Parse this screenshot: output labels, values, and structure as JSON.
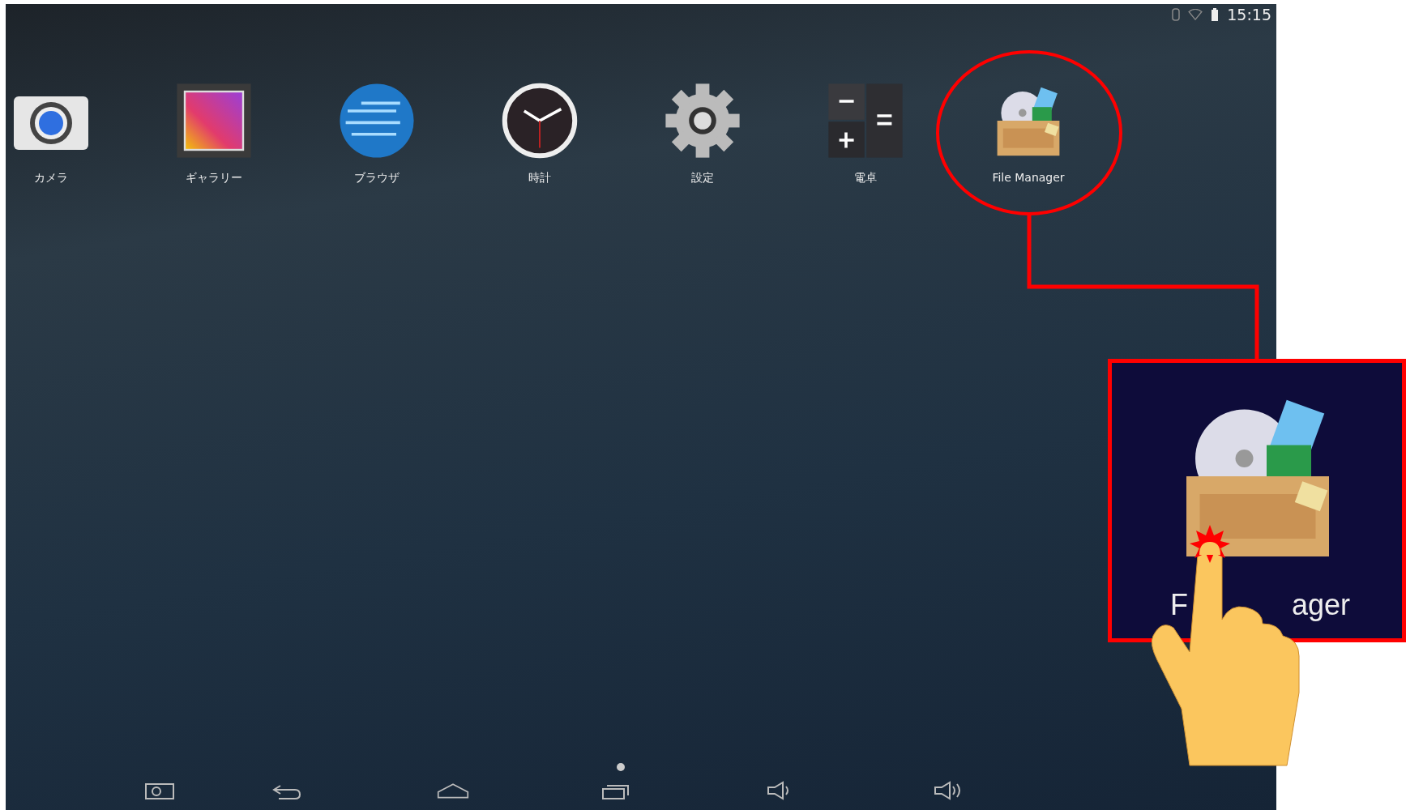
{
  "status_bar": {
    "time": "15:15"
  },
  "apps": [
    {
      "label": "カメラ",
      "kind": "camera"
    },
    {
      "label": "ギャラリー",
      "kind": "gallery"
    },
    {
      "label": "ブラウザ",
      "kind": "browser"
    },
    {
      "label": "時計",
      "kind": "clock"
    },
    {
      "label": "設定",
      "kind": "settings"
    },
    {
      "label": "電卓",
      "kind": "calculator"
    },
    {
      "label": "File Manager",
      "kind": "files"
    }
  ],
  "callout": {
    "label_start": "F",
    "label_end": "ager"
  }
}
